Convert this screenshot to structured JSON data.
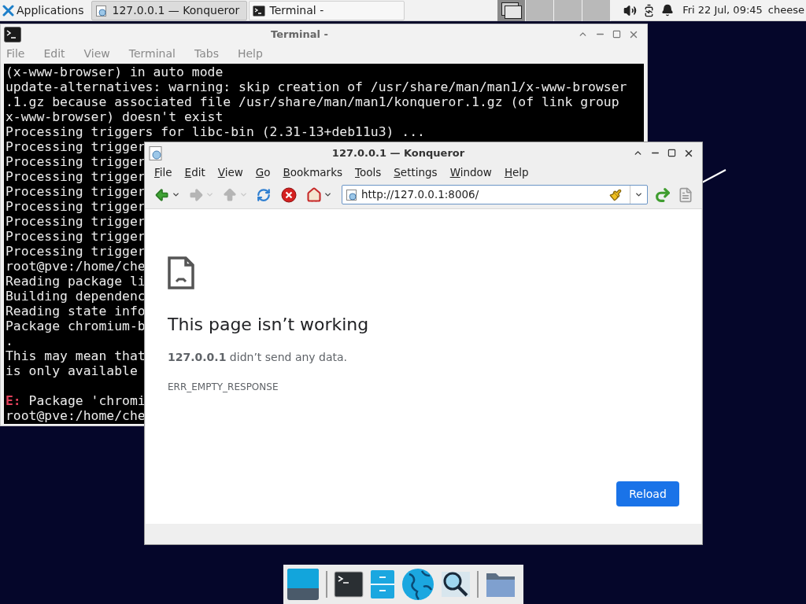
{
  "panel": {
    "applications": "Applications",
    "tasks": [
      {
        "label": "127.0.0.1 — Konqueror",
        "selected": true
      },
      {
        "label": "Terminal -",
        "selected": false
      }
    ],
    "workspaces": [
      {
        "selected": true
      },
      {
        "selected": false
      },
      {
        "selected": false
      },
      {
        "selected": false
      }
    ],
    "clock": "Fri 22 Jul, 09:45",
    "user": "cheese"
  },
  "terminal": {
    "title": "Terminal -",
    "menu": [
      "File",
      "Edit",
      "View",
      "Terminal",
      "Tabs",
      "Help"
    ],
    "lines": [
      {
        "text": "(x-www-browser) in auto mode"
      },
      {
        "text": "update-alternatives: warning: skip creation of /usr/share/man/man1/x-www-browser"
      },
      {
        "text": ".1.gz because associated file /usr/share/man/man1/konqueror.1.gz (of link group"
      },
      {
        "text": "x-www-browser) doesn't exist"
      },
      {
        "text": "Processing triggers for libc-bin (2.31-13+deb11u3) ..."
      },
      {
        "text": "Processing trigger"
      },
      {
        "text": "Processing trigger"
      },
      {
        "text": "Processing trigger"
      },
      {
        "text": "Processing trigger"
      },
      {
        "text": "Processing trigger"
      },
      {
        "text": "Processing trigger"
      },
      {
        "text": "Processing trigger"
      },
      {
        "text": "Processing trigger"
      },
      {
        "text": "root@pve:/home/che"
      },
      {
        "text": "Reading package li"
      },
      {
        "text": "Building dependenc"
      },
      {
        "text": "Reading state info"
      },
      {
        "text": "Package chromium-b"
      },
      {
        "text": "."
      },
      {
        "text": "This may mean that"
      },
      {
        "text": "is only available"
      },
      {
        "gap_before": true,
        "prefix": "E:",
        "text": " Package 'chromi"
      },
      {
        "text": "root@pve:/home/che"
      }
    ]
  },
  "browser": {
    "title": "127.0.0.1 — Konqueror",
    "menu": [
      "File",
      "Edit",
      "View",
      "Go",
      "Bookmarks",
      "Tools",
      "Settings",
      "Window",
      "Help"
    ],
    "toolbar": [
      {
        "kind": "back",
        "disabled": false,
        "has_menu": true
      },
      {
        "kind": "forward",
        "disabled": true,
        "has_menu": true
      },
      {
        "kind": "up",
        "disabled": true,
        "has_menu": true
      },
      {
        "kind": "reload",
        "disabled": false,
        "has_menu": false
      },
      {
        "kind": "stop",
        "disabled": false,
        "has_menu": false
      },
      {
        "kind": "home",
        "disabled": false,
        "has_menu": true
      }
    ],
    "url": "http://127.0.0.1:8006/",
    "heading": "This page isn’t working",
    "message": "**127.0.0.1** didn’t send any data.",
    "error_code": "ERR_EMPTY_RESPONSE",
    "reload_button": "Reload"
  }
}
